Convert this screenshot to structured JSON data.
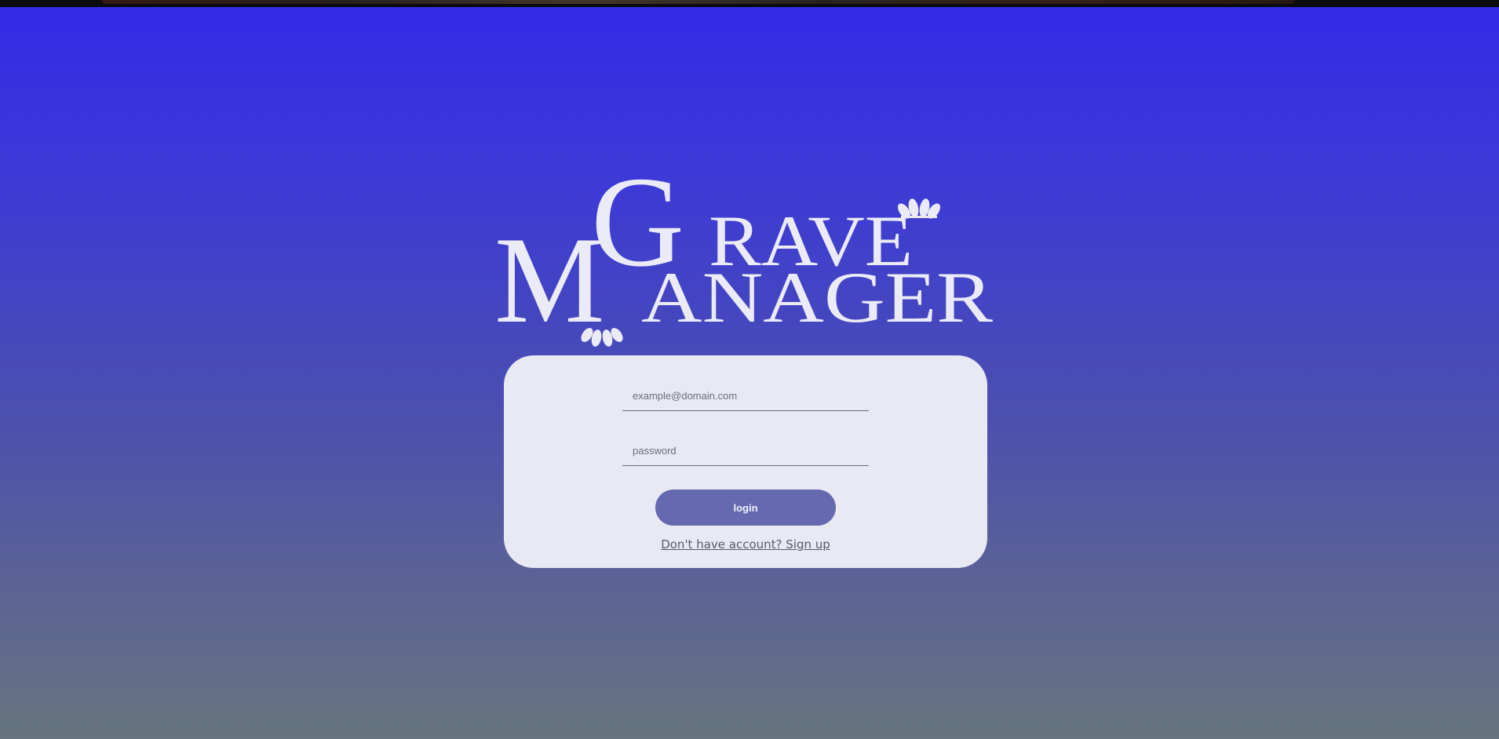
{
  "logo": {
    "line1_initial": "G",
    "line1_rest": "RAVE",
    "line2_initial": "M",
    "line2_rest": "ANAGER",
    "color": "#ebebf7"
  },
  "login_form": {
    "email_placeholder": "example@domain.com",
    "email_value": "",
    "password_placeholder": "password",
    "password_value": "",
    "login_label": "login",
    "signup_link": "Don't have account? Sign up"
  },
  "colors": {
    "background_top": "#322ae8",
    "background_bottom": "#66757f",
    "card": "#e9e9f4",
    "button": "#6569b0"
  }
}
